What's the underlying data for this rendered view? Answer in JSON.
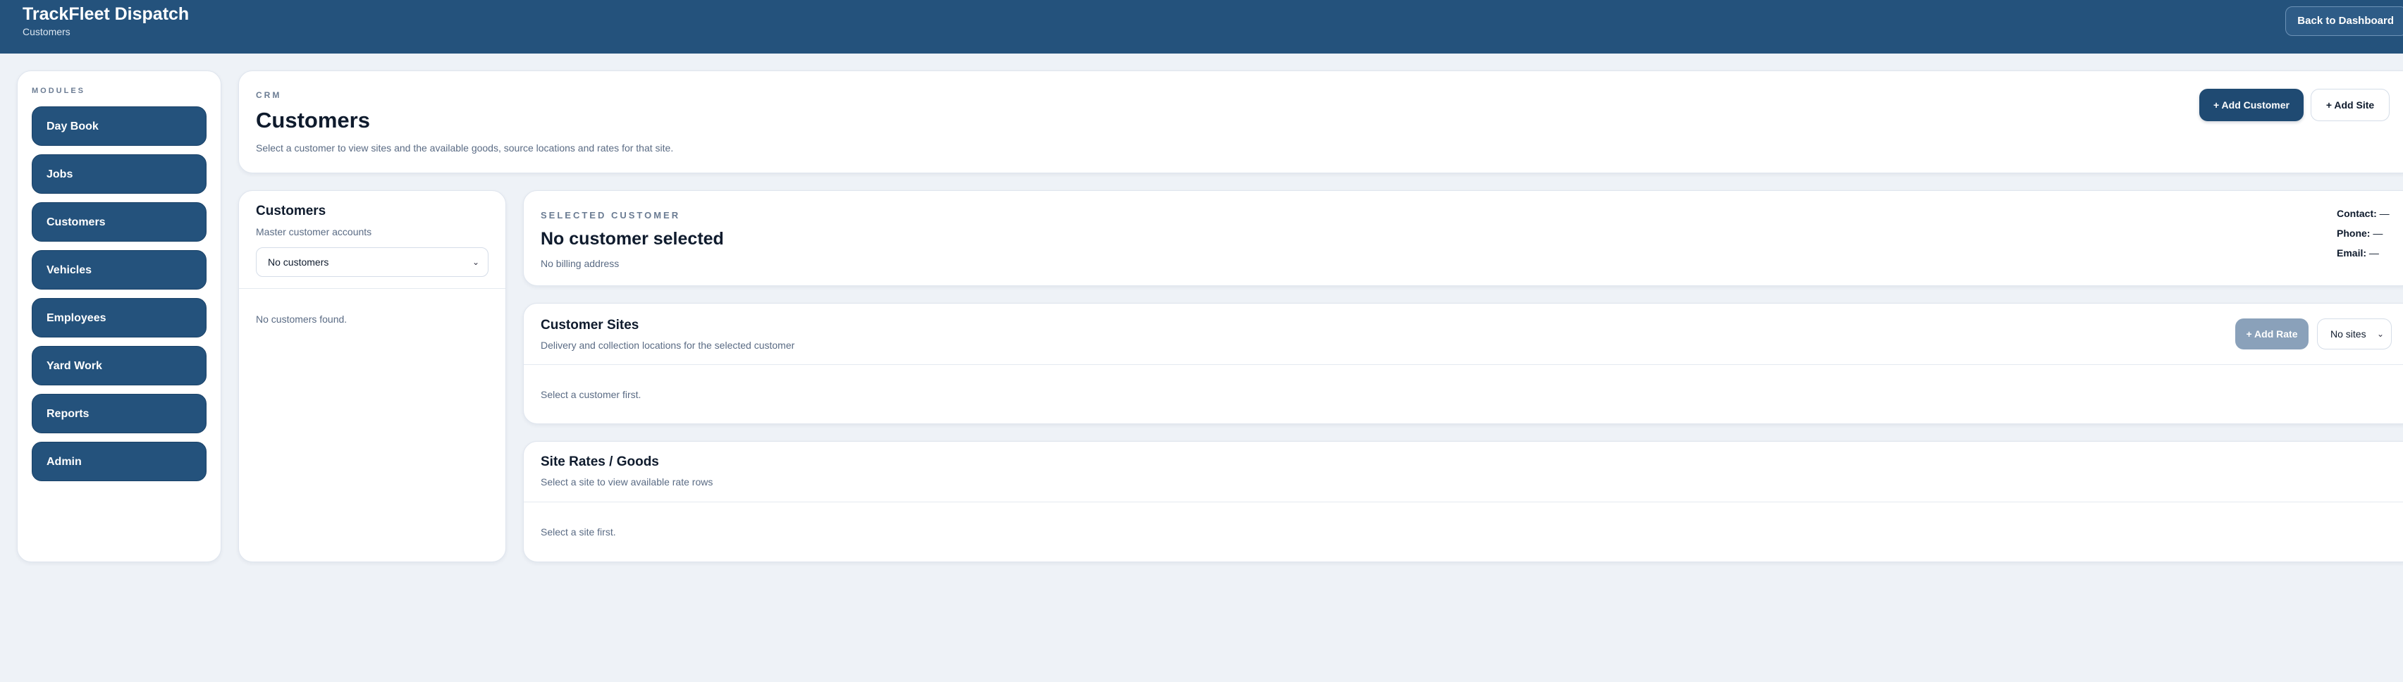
{
  "app": {
    "title": "TrackFleet Dispatch",
    "subtitle": "Customers",
    "back_label": "Back to Dashboard"
  },
  "sidebar": {
    "section_label": "MODULES",
    "items": [
      {
        "label": "Day Book"
      },
      {
        "label": "Jobs"
      },
      {
        "label": "Customers"
      },
      {
        "label": "Vehicles"
      },
      {
        "label": "Employees"
      },
      {
        "label": "Yard Work"
      },
      {
        "label": "Reports"
      },
      {
        "label": "Admin"
      }
    ]
  },
  "header": {
    "eyebrow": "CRM",
    "title": "Customers",
    "description": "Select a customer to view sites and the available goods, source locations and rates for that site.",
    "add_customer_label": "+ Add Customer",
    "add_site_label": "+ Add Site"
  },
  "customers_panel": {
    "title": "Customers",
    "subtitle": "Master customer accounts",
    "select_value": "No customers",
    "empty_text": "No customers found."
  },
  "selected_customer": {
    "eyebrow": "SELECTED CUSTOMER",
    "name": "No customer selected",
    "billing": "No billing address",
    "contact_label": "Contact:",
    "contact_value": "—",
    "phone_label": "Phone:",
    "phone_value": "—",
    "email_label": "Email:",
    "email_value": "—"
  },
  "sites_panel": {
    "title": "Customer Sites",
    "subtitle": "Delivery and collection locations for the selected customer",
    "add_rate_label": "+ Add Rate",
    "select_value": "No sites",
    "empty_text": "Select a customer first."
  },
  "rates_panel": {
    "title": "Site Rates / Goods",
    "subtitle": "Select a site to view available rate rows",
    "empty_text": "Select a site first."
  },
  "colors": {
    "brand": "#24527c",
    "background": "#eef2f7",
    "muted_button": "#8aa1ba"
  }
}
